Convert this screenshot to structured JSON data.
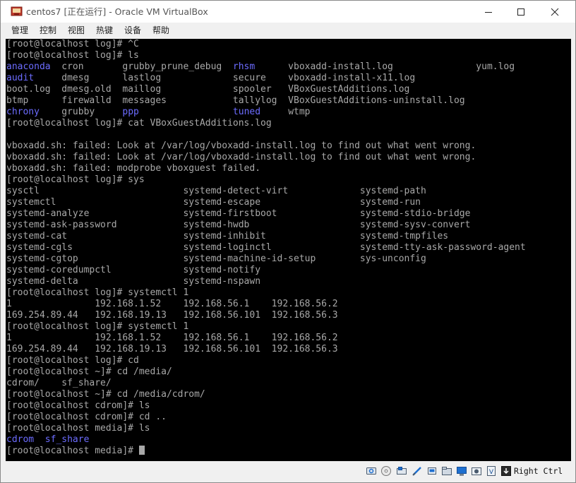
{
  "window": {
    "title": "centos7 [正在运行] - Oracle VM VirtualBox",
    "controls": [
      "minimize",
      "maximize",
      "close"
    ]
  },
  "menu": {
    "items": [
      "管理",
      "控制",
      "视图",
      "热键",
      "设备",
      "帮助"
    ]
  },
  "terminal": {
    "lines": [
      [
        {
          "t": "[root@localhost log]# ^C"
        }
      ],
      [
        {
          "t": "[root@localhost log]# ls"
        }
      ],
      [
        {
          "t": "anaconda",
          "c": "blue"
        },
        {
          "t": "  cron       grubby_prune_debug  "
        },
        {
          "t": "rhsm",
          "c": "blue"
        },
        {
          "t": "      vboxadd-install.log               yum.log"
        }
      ],
      [
        {
          "t": "audit",
          "c": "blue"
        },
        {
          "t": "     dmesg      lastlog             secure    vboxadd-install-x11.log"
        }
      ],
      [
        {
          "t": "boot.log  dmesg.old  maillog             spooler   VBoxGuestAdditions.log"
        }
      ],
      [
        {
          "t": "btmp      firewalld  messages            tallylog  VBoxGuestAdditions-uninstall.log"
        }
      ],
      [
        {
          "t": "chrony",
          "c": "blue"
        },
        {
          "t": "    grubby     "
        },
        {
          "t": "ppp",
          "c": "blue"
        },
        {
          "t": "                 "
        },
        {
          "t": "tuned",
          "c": "blue"
        },
        {
          "t": "     wtmp"
        }
      ],
      [
        {
          "t": "[root@localhost log]# cat VBoxGuestAdditions.log"
        }
      ],
      [
        {
          "t": ""
        }
      ],
      [
        {
          "t": "vboxadd.sh: failed: Look at /var/log/vboxadd-install.log to find out what went wrong."
        }
      ],
      [
        {
          "t": "vboxadd.sh: failed: Look at /var/log/vboxadd-install.log to find out what went wrong."
        }
      ],
      [
        {
          "t": "vboxadd.sh: failed: modprobe vboxguest failed."
        }
      ],
      [
        {
          "t": "[root@localhost log]# sys"
        }
      ],
      [
        {
          "t": "sysctl                          systemd-detect-virt             systemd-path"
        }
      ],
      [
        {
          "t": "systemctl                       systemd-escape                  systemd-run"
        }
      ],
      [
        {
          "t": "systemd-analyze                 systemd-firstboot               systemd-stdio-bridge"
        }
      ],
      [
        {
          "t": "systemd-ask-password            systemd-hwdb                    systemd-sysv-convert"
        }
      ],
      [
        {
          "t": "systemd-cat                     systemd-inhibit                 systemd-tmpfiles"
        }
      ],
      [
        {
          "t": "systemd-cgls                    systemd-loginctl                systemd-tty-ask-password-agent"
        }
      ],
      [
        {
          "t": "systemd-cgtop                   systemd-machine-id-setup        sys-unconfig"
        }
      ],
      [
        {
          "t": "systemd-coredumpctl             systemd-notify"
        }
      ],
      [
        {
          "t": "systemd-delta                   systemd-nspawn"
        }
      ],
      [
        {
          "t": "[root@localhost log]# systemctl 1"
        }
      ],
      [
        {
          "t": "1               192.168.1.52    192.168.56.1    192.168.56.2"
        }
      ],
      [
        {
          "t": "169.254.89.44   192.168.19.13   192.168.56.101  192.168.56.3"
        }
      ],
      [
        {
          "t": "[root@localhost log]# systemctl 1"
        }
      ],
      [
        {
          "t": "1               192.168.1.52    192.168.56.1    192.168.56.2"
        }
      ],
      [
        {
          "t": "169.254.89.44   192.168.19.13   192.168.56.101  192.168.56.3"
        }
      ],
      [
        {
          "t": "[root@localhost log]# cd"
        }
      ],
      [
        {
          "t": "[root@localhost ~]# cd /media/"
        }
      ],
      [
        {
          "t": "cdrom/    sf_share/"
        }
      ],
      [
        {
          "t": "[root@localhost ~]# cd /media/cdrom/"
        }
      ],
      [
        {
          "t": "[root@localhost cdrom]# ls"
        }
      ],
      [
        {
          "t": "[root@localhost cdrom]# cd .."
        }
      ],
      [
        {
          "t": "[root@localhost media]# ls"
        }
      ],
      [
        {
          "t": "cdrom",
          "c": "blue"
        },
        {
          "t": "  "
        },
        {
          "t": "sf_share",
          "c": "blue"
        }
      ],
      [
        {
          "t": "[root@localhost media]# "
        }
      ]
    ]
  },
  "statusbar": {
    "icons": [
      "hard-disk-icon",
      "optical-drive-icon",
      "audio-icon",
      "network-icon",
      "usb-icon",
      "shared-folders-icon",
      "display-icon",
      "recording-icon",
      "capture-icon",
      "cpu-icon",
      "mouse-integration-icon",
      "keyboard-icon"
    ],
    "host_key": "Right Ctrl"
  },
  "colors": {
    "terminal_bg": "#000000",
    "terminal_fg": "#a8a8a8",
    "dir_blue": "#6c6cff",
    "chrome": "#f0f0f0"
  }
}
